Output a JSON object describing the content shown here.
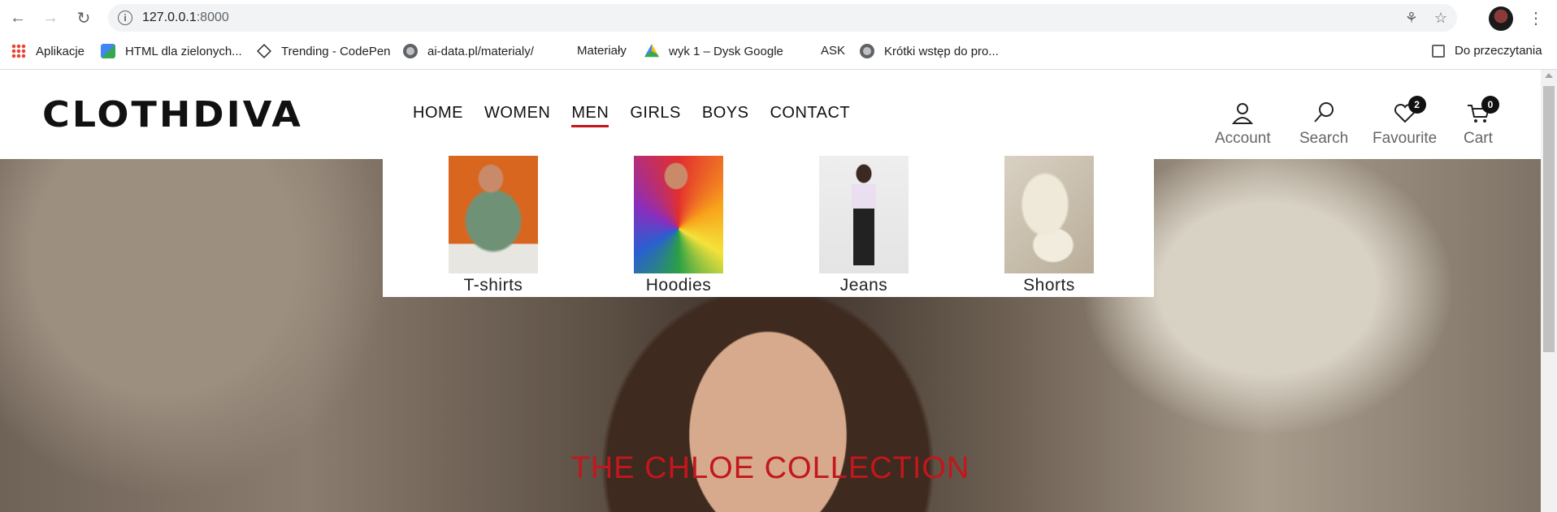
{
  "browser": {
    "url_host": "127.0.0.1",
    "url_port": ":8000",
    "bookmarks": [
      {
        "label": "Aplikacje"
      },
      {
        "label": "HTML dla zielonych..."
      },
      {
        "label": "Trending - CodePen"
      },
      {
        "label": "ai-data.pl/materialy/"
      },
      {
        "label": "Materiały"
      },
      {
        "label": "wyk 1 – Dysk Google"
      },
      {
        "label": "ASK"
      },
      {
        "label": "Krótki wstęp do pro..."
      }
    ],
    "reading_list": "Do przeczytania"
  },
  "site": {
    "logo": "CLOTHDIVA",
    "nav": [
      {
        "label": "HOME"
      },
      {
        "label": "WOMEN"
      },
      {
        "label": "MEN"
      },
      {
        "label": "GIRLS"
      },
      {
        "label": "BOYS"
      },
      {
        "label": "CONTACT"
      }
    ],
    "active_nav": "MEN",
    "tools": {
      "account": "Account",
      "search": "Search",
      "favourite": "Favourite",
      "favourite_count": "2",
      "cart": "Cart",
      "cart_count": "0"
    },
    "mega_menu": [
      {
        "label": "T-shirts"
      },
      {
        "label": "Hoodies"
      },
      {
        "label": "Jeans"
      },
      {
        "label": "Shorts"
      }
    ],
    "hero_title": "THE CHLOE COLLECTION",
    "accent_color": "#c4161c"
  }
}
